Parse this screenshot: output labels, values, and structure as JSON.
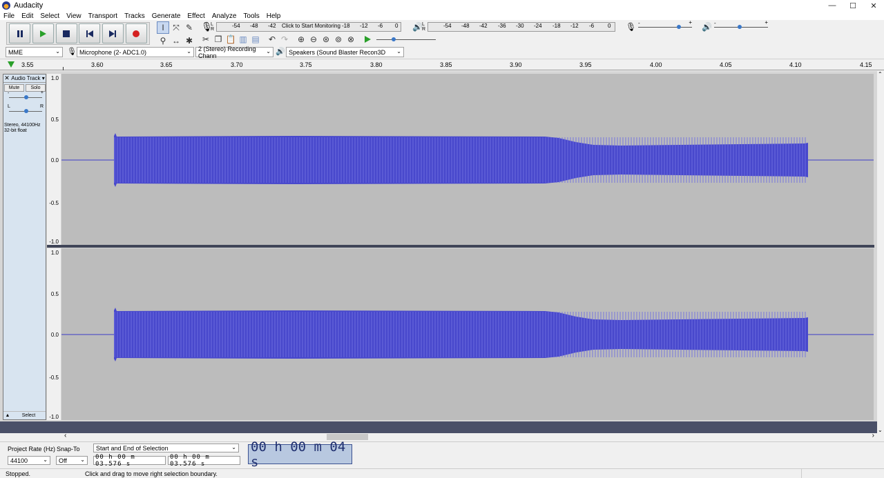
{
  "window": {
    "title": "Audacity",
    "minimize": "—",
    "maximize": "☐",
    "close": "✕"
  },
  "menu": [
    "File",
    "Edit",
    "Select",
    "View",
    "Transport",
    "Tracks",
    "Generate",
    "Effect",
    "Analyze",
    "Tools",
    "Help"
  ],
  "record_meter": {
    "lr": "L\nR",
    "hint": "Click to Start Monitoring",
    "ticks": [
      "-54",
      "-48",
      "-42",
      "-18",
      "-12",
      "-6",
      "0"
    ]
  },
  "play_meter": {
    "lr": "L\nR",
    "ticks": [
      "-54",
      "-48",
      "-42",
      "-36",
      "-30",
      "-24",
      "-18",
      "-12",
      "-6",
      "0"
    ]
  },
  "mixer": {
    "rec_minus": "-",
    "rec_plus": "+",
    "play_minus": "-",
    "play_plus": "+"
  },
  "device": {
    "host": "MME",
    "input": "Microphone (2- ADC1.0)",
    "channels": "2 (Stereo) Recording Chann",
    "output": "Speakers (Sound Blaster Recon3D"
  },
  "timeline": {
    "start": "3.55",
    "ticks": [
      "3.60",
      "3.65",
      "3.70",
      "3.75",
      "3.80",
      "3.85",
      "3.90",
      "3.95",
      "4.00",
      "4.05",
      "4.10",
      "4.15"
    ]
  },
  "track": {
    "name": "Audio Track",
    "mute": "Mute",
    "solo": "Solo",
    "gain_minus": "-",
    "gain_plus": "+",
    "pan_left": "L",
    "pan_right": "R",
    "format_line1": "Stereo, 44100Hz",
    "format_line2": "32-bit float",
    "select": "Select",
    "collapse": "▲"
  },
  "vruler": [
    "1.0",
    "0.5",
    "0.0",
    "-0.5",
    "-1.0"
  ],
  "selection_toolbar": {
    "project_rate_label": "Project Rate (Hz)",
    "project_rate": "44100",
    "snap_label": "Snap-To",
    "snap_value": "Off",
    "mode": "Start and End of Selection",
    "start_time": "00 h 00 m 03.576 s",
    "end_time": "00 h 00 m 03.576 s",
    "audio_position": "00 h 00 m 04 s"
  },
  "status": {
    "state": "Stopped.",
    "hint": "Click and drag to move right selection boundary."
  },
  "colors": {
    "waveform": "#3c3cc8",
    "wave_bg": "#bcbcbc",
    "track_panel": "#d8e4f0",
    "record": "#d42020",
    "play": "#2aa02a"
  }
}
